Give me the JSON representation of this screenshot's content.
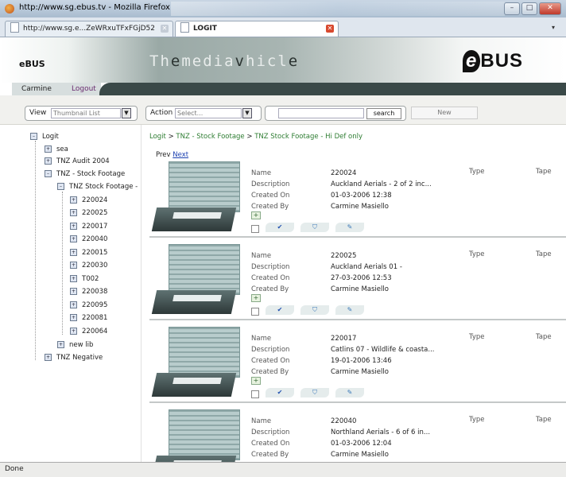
{
  "window": {
    "title": "http://www.sg.ebus.tv - Mozilla Firefox"
  },
  "tabs": [
    {
      "label": "http://www.sg.e...ZeWRxuTFxFGjD52"
    },
    {
      "label": "LOGIT"
    }
  ],
  "header": {
    "brand": "eBUS",
    "tagline_ghost": "Th",
    "tagline_parts": [
      "e",
      "media",
      "v",
      "hicl",
      "e"
    ],
    "logo_mark": "e",
    "logo_text": "BUS"
  },
  "user": {
    "name": "Carmine",
    "logout": "Logout"
  },
  "toolbar": {
    "view_label": "View",
    "view_value": "Thumbnail List",
    "action_label": "Action",
    "action_placeholder": "Select...",
    "search_value": "",
    "search_button": "search",
    "new_button": "New"
  },
  "tree": {
    "root": "Logit",
    "children": [
      "sea",
      "TNZ Audit 2004",
      "TNZ - Stock Footage"
    ],
    "sub": "TNZ Stock Footage -",
    "leaves": [
      "220024",
      "220025",
      "220017",
      "220040",
      "220015",
      "220030",
      "T002",
      "220038",
      "220095",
      "220081",
      "220064"
    ],
    "after": [
      "new lib",
      "TNZ Negative"
    ]
  },
  "breadcrumb": [
    "Logit",
    "TNZ - Stock Footage",
    "TNZ Stock Footage - Hi Def only"
  ],
  "pager": {
    "prev": "Prev",
    "next": "Next"
  },
  "field_labels": {
    "name": "Name",
    "description": "Description",
    "created_on": "Created On",
    "created_by": "Created By",
    "type": "Type",
    "tape": "Tape"
  },
  "records": [
    {
      "name": "220024",
      "description": "Auckland Aerials - 2 of 2 inc...",
      "created_on": "01-03-2006 12:38",
      "created_by": "Carmine Masiello"
    },
    {
      "name": "220025",
      "description": "Auckland Aerials 01 -",
      "created_on": "27-03-2006 12:53",
      "created_by": "Carmine Masiello"
    },
    {
      "name": "220017",
      "description": "Catlins 07 - Wildlife & coasta...",
      "created_on": "19-01-2006 13:46",
      "created_by": "Carmine Masiello"
    },
    {
      "name": "220040",
      "description": "Northland Aerials - 6 of 6 in...",
      "created_on": "01-03-2006 12:04",
      "created_by": "Carmine Masiello"
    }
  ],
  "status": {
    "text": "Done"
  }
}
